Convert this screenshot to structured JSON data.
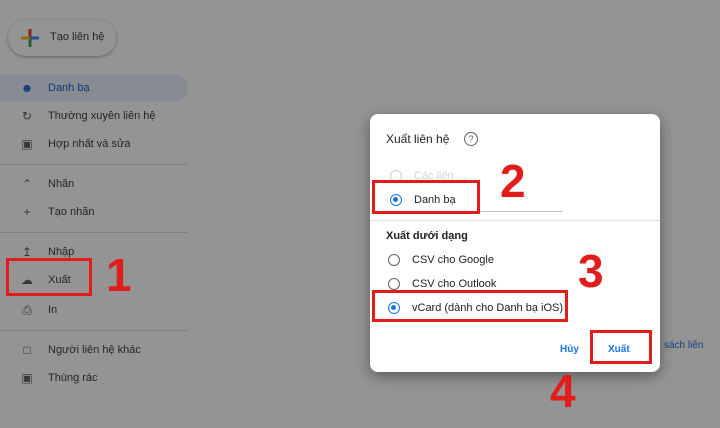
{
  "sidebar": {
    "create_label": "Tạo liên hệ",
    "items": [
      {
        "label": "Danh bạ",
        "icon": "person-icon"
      },
      {
        "label": "Thường xuyên liên hệ",
        "icon": "history-icon"
      },
      {
        "label": "Hợp nhất và sửa",
        "icon": "merge-icon"
      },
      {
        "label": "Nhãn",
        "icon": "chevron-up-icon"
      },
      {
        "label": "Tạo nhãn",
        "icon": "plus-icon"
      },
      {
        "label": "Nhập",
        "icon": "upload-icon"
      },
      {
        "label": "Xuất",
        "icon": "cloud-download-icon"
      },
      {
        "label": "In",
        "icon": "print-icon"
      },
      {
        "label": "Người liên hệ khác",
        "icon": "contact-add-icon"
      },
      {
        "label": "Thùng rác",
        "icon": "trash-icon"
      }
    ]
  },
  "background": {
    "partial_link": "sách liên"
  },
  "dialog": {
    "title": "Xuất liên hệ",
    "faded_option": "Các liên ...",
    "contacts_option": "Danh bạ",
    "format_title": "Xuất dưới dạng",
    "formats": [
      "CSV cho Google",
      "CSV cho Outlook",
      "vCard (dành cho Danh bạ iOS)"
    ],
    "cancel_label": "Hủy",
    "export_label": "Xuất"
  },
  "annotations": [
    "1",
    "2",
    "3",
    "4"
  ],
  "colors": {
    "accent": "#1a73e8",
    "annotation": "#e21b1b"
  }
}
